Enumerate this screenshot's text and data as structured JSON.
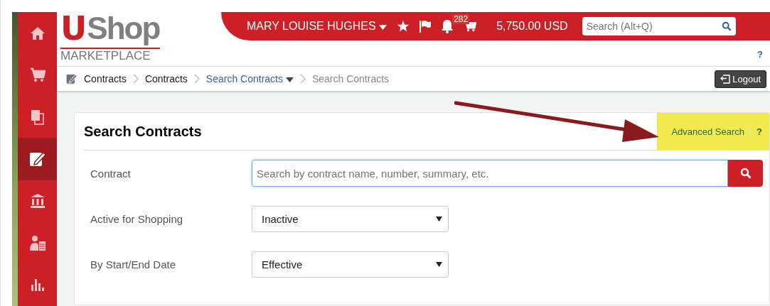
{
  "sidebar": {
    "items": [
      {
        "kind": "home",
        "selected": false
      },
      {
        "kind": "cart",
        "selected": false
      },
      {
        "kind": "documents",
        "selected": false
      },
      {
        "kind": "contracts",
        "selected": true
      },
      {
        "kind": "bank",
        "selected": false
      },
      {
        "kind": "people",
        "selected": false
      },
      {
        "kind": "reports",
        "selected": false
      }
    ]
  },
  "logo": {
    "letter": "U",
    "word": "Shop",
    "tagline": "MARKETPLACE"
  },
  "top_bar": {
    "user": "MARY LOUISE HUGHES",
    "notifications": "282",
    "cart_total": "5,750.00 USD",
    "search": {
      "placeholder": "Search (Alt+Q)"
    },
    "help": "?"
  },
  "breadcrumbs": [
    {
      "label": "Contracts",
      "kind": "text"
    },
    {
      "label": "Contracts",
      "kind": "text"
    },
    {
      "label": "Search Contracts",
      "kind": "menu"
    },
    {
      "label": "Search Contracts",
      "kind": "current"
    }
  ],
  "logout": "Logout",
  "card": {
    "title": "Search Contracts",
    "advanced_search": "Advanced Search",
    "help": "?",
    "highlighted": true,
    "fields": [
      {
        "label": "Contract",
        "kind": "search",
        "placeholder": "Search by contract name, number, summary, etc."
      },
      {
        "label": "Active for Shopping",
        "kind": "select",
        "value": "Inactive"
      },
      {
        "label": "By Start/End Date",
        "kind": "select",
        "value": "Effective"
      }
    ]
  },
  "annotation": {
    "arrow": true
  }
}
